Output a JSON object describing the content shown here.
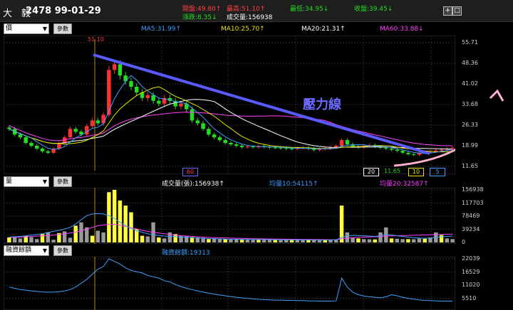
{
  "header": {
    "stock_name": "大　毅",
    "stock_code_date": "2478 99-01-29",
    "quotes": [
      {
        "label": "開盤:49.80↑",
        "color": "#ff4040"
      },
      {
        "label": "漲跌:8.35↓",
        "color": "#22dd22"
      },
      {
        "label": "最高:51.10↑",
        "color": "#ff4040"
      },
      {
        "label": "成交量:156938",
        "color": "#ffffff"
      },
      {
        "label": "最低:34.95↓",
        "color": "#22dd22"
      },
      {
        "label": "收盤:39.45↓",
        "color": "#22dd22"
      }
    ],
    "add_button": "+",
    "window_button": "□"
  },
  "price_panel": {
    "selector": "價",
    "params_button": "參數",
    "indicators": [
      {
        "label": "MA5:31.99↑",
        "color": "#3fa0ff"
      },
      {
        "label": "MA10:25.70↑",
        "color": "#e6e600"
      },
      {
        "label": "MA20:21.31↑",
        "color": "#ffffff"
      },
      {
        "label": "MA60:33.88↓",
        "color": "#ff40ff"
      }
    ],
    "high_marker": "51.10",
    "low_marker": "11.65",
    "pressure_label": "壓力線",
    "bottom_markers": [
      "60",
      "20",
      "10",
      "5"
    ]
  },
  "volume_panel": {
    "selector": "量",
    "params_button": "參數",
    "indicators": [
      {
        "label": "成交量(張):156938↑",
        "color": "#ffffff"
      },
      {
        "label": "均量10:54115↑",
        "color": "#3fa0ff"
      },
      {
        "label": "均量20:32587↑",
        "color": "#ff40ff"
      }
    ]
  },
  "margin_panel": {
    "selector": "融資餘額",
    "params_button": "參數",
    "indicators": [
      {
        "label": "融資餘額:19313",
        "color": "#3fa0ff"
      }
    ]
  },
  "chart_data": [
    {
      "type": "candlestick",
      "title": "價",
      "ylim": [
        11.65,
        55.71
      ],
      "y_ticks": [
        "55.71",
        "48.36",
        "41.02",
        "33.68",
        "26.33",
        "18.99",
        "11.65"
      ],
      "grid": true,
      "close": [
        25,
        23,
        22,
        20,
        19,
        18,
        17,
        16.5,
        18,
        20,
        22,
        25,
        24,
        23,
        26,
        28,
        27,
        30,
        46,
        48,
        44,
        42,
        40,
        38,
        36,
        37,
        35,
        34,
        36,
        35,
        33,
        34,
        32,
        28,
        27,
        25,
        23,
        22,
        21,
        20,
        19.5,
        19,
        18.5,
        18.7,
        18.5,
        18.9,
        18.6,
        18.4,
        18.3,
        18.2,
        18.0,
        17.9,
        18.1,
        18.3,
        18,
        17.5,
        17.8,
        18,
        18.4,
        19,
        21,
        19.5,
        18.8,
        18.5,
        19,
        19.2,
        18.7,
        18.3,
        18,
        17.6,
        17.2,
        16.5,
        16,
        15.8,
        16.5,
        16.8,
        17,
        17.3,
        17.6,
        18,
        18.3
      ]
    },
    {
      "type": "bar",
      "title": "量",
      "ylim": [
        0,
        156938
      ],
      "y_ticks": [
        "156938",
        "117703",
        "78469",
        "39234",
        "0"
      ],
      "grid": true,
      "values": [
        15000,
        18000,
        12000,
        20000,
        16000,
        10000,
        25000,
        30000,
        8000,
        28000,
        33000,
        14000,
        50000,
        60000,
        45000,
        20000,
        35000,
        30000,
        150000,
        156938,
        125000,
        110000,
        90000,
        40000,
        20000,
        18000,
        60000,
        15000,
        12000,
        30000,
        25000,
        20000,
        18000,
        16000,
        15000,
        14000,
        10000,
        12000,
        11000,
        10000,
        9000,
        8500,
        8000,
        8200,
        7800,
        7600,
        8000,
        7500,
        7200,
        7000,
        7400,
        7100,
        6900,
        7000,
        6800,
        6600,
        6900,
        7000,
        7200,
        7500,
        110000,
        30000,
        15000,
        12000,
        10000,
        9500,
        9000,
        30000,
        45000,
        12000,
        11000,
        10000,
        9800,
        9600,
        12000,
        11000,
        15000,
        30000,
        22000,
        12000,
        10000
      ],
      "series": [
        {
          "name": "均量10",
          "values": [
            16000,
            17000,
            18000,
            20000,
            22000,
            24000,
            26000,
            30000,
            33000,
            36000,
            40000,
            45000,
            55000,
            68000,
            80000,
            85000,
            86000,
            85000,
            80000,
            72000,
            60000,
            50000,
            42000,
            35000,
            30000,
            26000,
            23000,
            21000,
            19000,
            18000,
            17000,
            16000,
            15000,
            14000,
            13000,
            12000,
            11500,
            11000,
            10500,
            10000,
            9800,
            9600,
            9400,
            9200,
            9000,
            8800,
            8600,
            8400,
            8200,
            8000,
            7900,
            7800,
            7700,
            7600,
            7500,
            7400,
            7300,
            7300,
            7400,
            7600,
            15000,
            20000,
            21000,
            20500,
            20000,
            19000,
            18000,
            20000,
            24000,
            22000,
            20000,
            18000,
            16000,
            14000,
            13000,
            12500,
            13000,
            15000,
            17000,
            18000,
            19000
          ]
        },
        {
          "name": "均量20",
          "values": [
            15000,
            15500,
            16000,
            17000,
            18000,
            19000,
            20000,
            21000,
            22000,
            24000,
            26000,
            28000,
            31000,
            35000,
            40000,
            45000,
            50000,
            52000,
            54000,
            54115,
            52000,
            48000,
            44000,
            40000,
            36000,
            33000,
            30000,
            28000,
            26000,
            24000,
            22000,
            20000,
            19000,
            18000,
            17000,
            16000,
            15000,
            14500,
            14000,
            13500,
            13000,
            12500,
            12000,
            11500,
            11000,
            10800,
            10600,
            10400,
            10200,
            10000,
            9800,
            9600,
            9400,
            9200,
            9000,
            8800,
            8600,
            8400,
            8300,
            8200,
            11000,
            13000,
            14000,
            15000,
            16000,
            16500,
            17000,
            18000,
            19000,
            19500,
            20000,
            20500,
            21000,
            21500,
            22000,
            22500,
            23000,
            23500,
            24000,
            24500,
            25000
          ]
        }
      ]
    },
    {
      "type": "line",
      "title": "融資餘額",
      "ylim": [
        0,
        22039
      ],
      "y_ticks": [
        "22039",
        "16529",
        "11020",
        "5510"
      ],
      "grid": true,
      "series": [
        {
          "name": "融資餘額",
          "values": [
            11000,
            10500,
            10000,
            9800,
            9500,
            9300,
            9100,
            9000,
            9000,
            9200,
            9500,
            10000,
            11000,
            12500,
            14000,
            16000,
            18000,
            19000,
            22039,
            21000,
            20000,
            18500,
            17500,
            17000,
            16500,
            15500,
            15000,
            14500,
            13500,
            13000,
            12000,
            11200,
            10500,
            10000,
            9500,
            9000,
            8600,
            8200,
            7900,
            7600,
            7300,
            7000,
            6800,
            6600,
            6400,
            6200,
            6100,
            6000,
            5900,
            5900,
            5800,
            5800,
            5700,
            5700,
            5600,
            5600,
            5500,
            5500,
            5500,
            5600,
            14500,
            11000,
            9000,
            8000,
            7500,
            7200,
            7000,
            6800,
            7200,
            8000,
            7600,
            7000,
            6600,
            6300,
            6000,
            5800,
            5700,
            5600,
            5500,
            5500,
            5510
          ]
        }
      ]
    }
  ]
}
